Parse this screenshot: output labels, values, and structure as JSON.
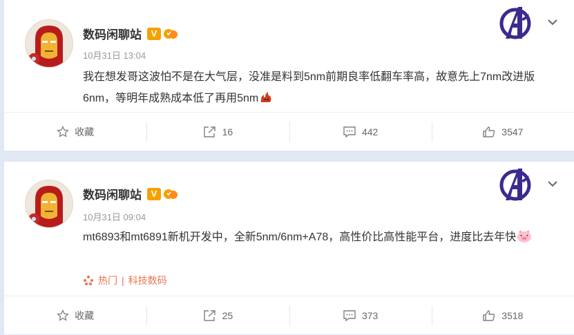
{
  "posts": [
    {
      "author": "数码闲聊站",
      "verified_badge": "V",
      "timestamp": "10月31日 13:04",
      "text": "我在想发哥这波怕不是在大气层，没准是料到5nm前期良率低翻车率高，故意先上7nm改进版6nm，等明年成熟成本低了再用5nm",
      "emoji": "doge-fire-icon",
      "tags": [],
      "actions": {
        "favorite": "收藏",
        "repost": "16",
        "comment": "442",
        "like": "3547"
      }
    },
    {
      "author": "数码闲聊站",
      "verified_badge": "V",
      "timestamp": "10月31日 09:04",
      "text": "mt6893和mt6891新机开发中，全新5nm/6nm+A78，高性价比高性能平台，进度比去年快",
      "emoji": "pig-face-icon",
      "tags": [
        "热门",
        "科技数码"
      ],
      "actions": {
        "favorite": "收藏",
        "repost": "25",
        "comment": "373",
        "like": "3518"
      }
    }
  ],
  "colors": {
    "accent": "#eb7350",
    "badge": "#f6a100",
    "avengers": "#3b2a8f",
    "background": "#dfe8f3"
  }
}
